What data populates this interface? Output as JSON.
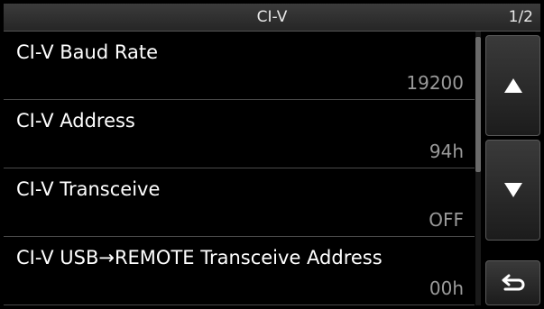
{
  "header": {
    "title": "CI-V",
    "page_indicator": "1/2"
  },
  "items": [
    {
      "label": "CI-V Baud Rate",
      "value": "19200"
    },
    {
      "label": "CI-V Address",
      "value": "94h"
    },
    {
      "label": "CI-V Transceive",
      "value": "OFF"
    },
    {
      "label": "CI-V USB→REMOTE Transceive Address",
      "value": "00h"
    }
  ],
  "buttons": {
    "up_icon": "triangle-up-icon",
    "down_icon": "triangle-down-icon",
    "back_icon": "return-arrow-icon"
  }
}
